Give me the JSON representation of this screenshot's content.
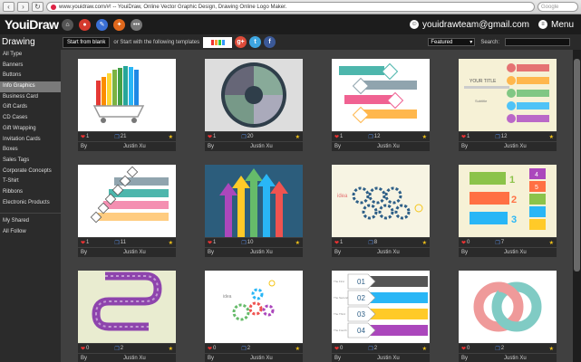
{
  "browser": {
    "url": "www.youidraw.com/#! -- YouiDraw, Online Vector Graphic Design, Drawing Online Logo Maker.",
    "search_placeholder": "Google"
  },
  "header": {
    "logo": "YouiDraw",
    "user_email": "youidrawteam@gmail.com",
    "menu_label": "Menu"
  },
  "toolbar": {
    "section_title": "Drawing",
    "start_blank": "Start from blank",
    "or_text": "or Start with the following templates",
    "featured": "Featured",
    "search_label": "Search:"
  },
  "sidebar": {
    "items": [
      "All Type",
      "Banners",
      "Buttons",
      "Info Graphics",
      "Business Card",
      "Gift Cards",
      "CD Cases",
      "Gift Wrapping",
      "Invitation Cards",
      "Boxes",
      "Sales Tags",
      "Corporate Concepts",
      "T-Shirt",
      "Ribbons",
      "Electronic Products"
    ],
    "active_index": 3,
    "bottom_items": [
      "My Shared",
      "All Follow"
    ]
  },
  "cards": [
    {
      "likes": "1",
      "copies": "21",
      "by": "By",
      "author": "Justin Xu"
    },
    {
      "likes": "1",
      "copies": "20",
      "by": "By",
      "author": "Justin Xu"
    },
    {
      "likes": "1",
      "copies": "12",
      "by": "By",
      "author": "Justin Xu"
    },
    {
      "likes": "1",
      "copies": "12",
      "by": "By",
      "author": "Justin Xu"
    },
    {
      "likes": "1",
      "copies": "11",
      "by": "By",
      "author": "Justin Xu"
    },
    {
      "likes": "1",
      "copies": "10",
      "by": "By",
      "author": "Justin Xu"
    },
    {
      "likes": "1",
      "copies": "8",
      "by": "By",
      "author": "Justin Xu"
    },
    {
      "likes": "0",
      "copies": "7",
      "by": "By",
      "author": "Justin Xu"
    },
    {
      "likes": "0",
      "copies": "2",
      "by": "By",
      "author": "Justin Xu"
    },
    {
      "likes": "0",
      "copies": "2",
      "by": "By",
      "author": "Justin Xu"
    },
    {
      "likes": "0",
      "copies": "2",
      "by": "By",
      "author": "Justin Xu"
    },
    {
      "likes": "0",
      "copies": "2",
      "by": "By",
      "author": "Justin Xu"
    }
  ],
  "thumb_texts": {
    "t4_title": "YOUR TITLE",
    "t4_sub": "Subtitle",
    "t7_idea": "idea",
    "t10_idea": "idea",
    "t11_n1": "01",
    "t11_n2": "02",
    "t11_n3": "03",
    "t11_n4": "04",
    "t11_l1": "The First",
    "t11_l2": "The Second",
    "t11_l3": "The Third",
    "t11_l4": "The Fourth",
    "t8_n1": "1",
    "t8_n2": "2",
    "t8_n3": "3",
    "t8_n4": "4",
    "t8_n5": "5"
  },
  "colors": {
    "header_bg": "#1c1c1c",
    "main_bg": "#404040",
    "like": "#e33333",
    "star": "#f5c518"
  }
}
